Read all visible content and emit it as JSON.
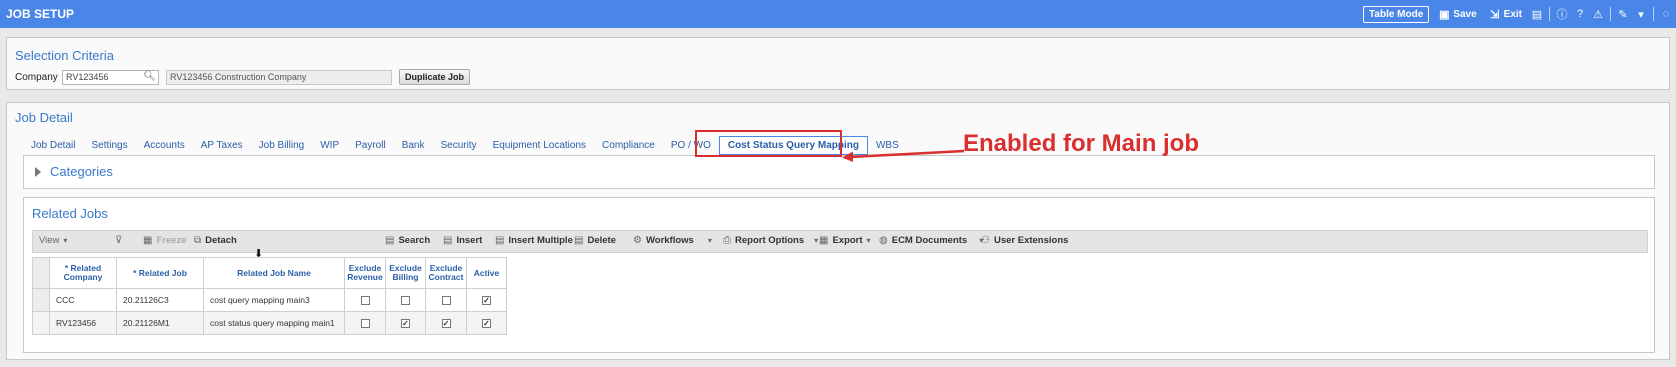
{
  "titlebar": {
    "title": "JOB SETUP",
    "table_mode_label": "Table Mode",
    "save_label": "Save",
    "exit_label": "Exit"
  },
  "selection": {
    "title": "Selection Criteria",
    "company_label": "Company",
    "company_value": "RV123456",
    "company_name_value": "RV123456  Construction Company",
    "duplicate_label": "Duplicate Job"
  },
  "job_detail": {
    "title": "Job Detail",
    "tabs": [
      {
        "label": "Job Detail"
      },
      {
        "label": "Settings"
      },
      {
        "label": "Accounts"
      },
      {
        "label": "AP Taxes"
      },
      {
        "label": "Job Billing"
      },
      {
        "label": "WIP"
      },
      {
        "label": "Payroll"
      },
      {
        "label": "Bank"
      },
      {
        "label": "Security"
      },
      {
        "label": "Equipment Locations"
      },
      {
        "label": "Compliance"
      },
      {
        "label": "PO / WO"
      },
      {
        "label": "Cost Status Query Mapping",
        "active": true
      },
      {
        "label": "WBS"
      }
    ],
    "annotation": "Enabled for Main job",
    "categories_title": "Categories"
  },
  "related_jobs": {
    "title": "Related Jobs",
    "toolbar": {
      "view": "View",
      "freeze": "Freeze",
      "detach": "Detach",
      "search": "Search",
      "insert": "Insert",
      "insert_multiple": "Insert Multiple",
      "delete": "Delete",
      "workflows": "Workflows",
      "report_options": "Report Options",
      "export": "Export",
      "ecm_documents": "ECM Documents",
      "user_extensions": "User Extensions"
    },
    "columns": {
      "related_company": "* Related Company",
      "related_job": "* Related Job",
      "related_job_name": "Related Job Name",
      "exclude_revenue": "Exclude Revenue",
      "exclude_billing": "Exclude Billing",
      "exclude_contract": "Exclude Contract",
      "active": "Active"
    },
    "rows": [
      {
        "company": "CCC",
        "job": "20.21126C3",
        "name": "cost query mapping main3",
        "exclude_revenue": false,
        "exclude_billing": false,
        "exclude_contract": false,
        "active": true
      },
      {
        "company": "RV123456",
        "job": "20.21126M1",
        "name": "cost status query mapping main1",
        "exclude_revenue": false,
        "exclude_billing": true,
        "exclude_contract": true,
        "active": true
      }
    ]
  },
  "colors": {
    "titlebar": "#4a86e8",
    "accent_text": "#3a79c9",
    "annotation": "#d92f2f"
  }
}
